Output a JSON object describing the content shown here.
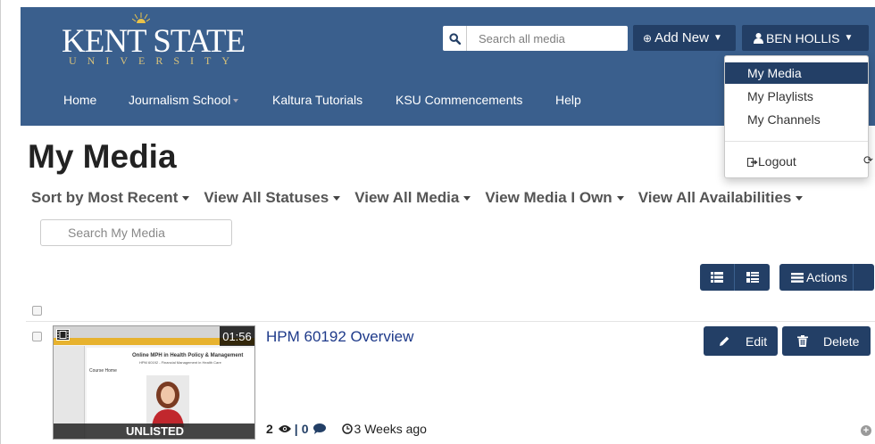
{
  "header": {
    "logo_main": "KENT STATE",
    "logo_sub": "UNIVERSITY",
    "search_placeholder": "Search all media",
    "add_new": "Add New",
    "user": "BEN HOLLIS",
    "nav": [
      "Home",
      "Journalism School",
      "Kaltura Tutorials",
      "KSU Commencements",
      "Help"
    ]
  },
  "user_menu": {
    "items": [
      "My Media",
      "My Playlists",
      "My Channels"
    ],
    "logout": "Logout"
  },
  "page": {
    "title": "My Media",
    "filters": [
      "Sort by Most Recent",
      "View All Statuses",
      "View All Media",
      "View Media I Own",
      "View All Availabilities"
    ],
    "search_placeholder": "Search My Media",
    "actions": "Actions"
  },
  "media": {
    "title": "HPM 60192 Overview",
    "duration": "01:56",
    "status": "UNLISTED",
    "views": "2",
    "comments": "0",
    "age": "3 Weeks ago",
    "edit": "Edit",
    "delete": "Delete",
    "thumb_title": "Online MPH in Health Policy & Management",
    "thumb_sub": "HPM 60192 - Financial Management in Health Care",
    "thumb_home": "Course Home"
  },
  "colors": {
    "header_bg": "#3a5f8d",
    "button_bg": "#233f66",
    "link": "#1e3a8a"
  }
}
